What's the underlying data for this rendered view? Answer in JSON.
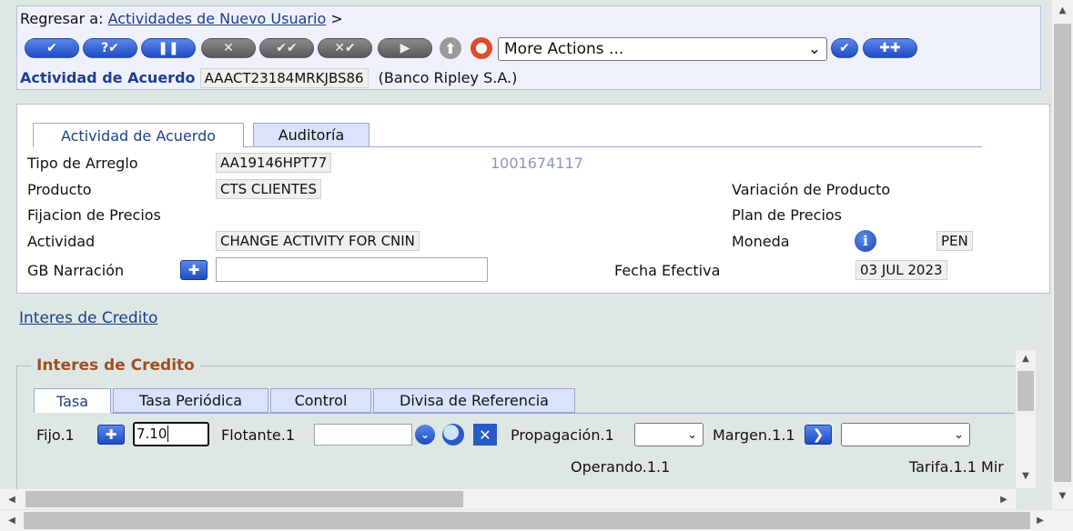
{
  "breadcrumb": {
    "prefix": "Regresar a:",
    "link": "Actividades de Nuevo Usuario",
    "suffix": ">"
  },
  "toolbar": {
    "buttons": [
      {
        "name": "commit-button",
        "glyph": "✔",
        "style": "blue"
      },
      {
        "name": "validate-button",
        "glyph": "?✔",
        "style": "blue"
      },
      {
        "name": "hold-button",
        "glyph": "❚❚",
        "style": "blue"
      },
      {
        "name": "delete-button",
        "glyph": "✕",
        "style": "gray"
      },
      {
        "name": "authorise-button",
        "glyph": "✔✔",
        "style": "gray"
      },
      {
        "name": "reverse-button",
        "glyph": "✕✔",
        "style": "gray"
      },
      {
        "name": "next-button",
        "glyph": "▶",
        "style": "gray"
      }
    ],
    "more_actions": "More Actions ..."
  },
  "record": {
    "label": "Actividad de Acuerdo",
    "id": "AAACT23184MRKJBS86",
    "bank": "(Banco Ripley S.A.)"
  },
  "main": {
    "tabs": [
      "Actividad de Acuerdo",
      "Auditoría"
    ],
    "fields": {
      "tipo_arreglo_label": "Tipo de Arreglo",
      "tipo_arreglo_value": "AA19146HPT77",
      "customer_number": "1001674117",
      "producto_label": "Producto",
      "producto_value": "CTS CLIENTES",
      "variacion_label": "Variación de Producto",
      "fijacion_label": "Fijacion de Precios",
      "plan_label": "Plan de Precios",
      "actividad_label": "Actividad",
      "actividad_value": "CHANGE ACTIVITY FOR CNIN",
      "moneda_label": "Moneda",
      "moneda_value": "PEN",
      "narracion_label": "GB Narración",
      "narracion_value": "",
      "fecha_label": "Fecha Efectiva",
      "fecha_value": "03 JUL 2023"
    }
  },
  "interes_link": "Interes de Credito",
  "interes": {
    "legend": "Interes de Credito",
    "tabs": [
      "Tasa",
      "Tasa Periódica",
      "Control",
      "Divisa de Referencia"
    ],
    "fijo_label": "Fijo.1",
    "fijo_value": "7.10",
    "flotante_label": "Flotante.1",
    "flotante_value": "",
    "propagacion_label": "Propagación.1",
    "margen_label": "Margen.1.1",
    "operando_label": "Operando.1.1",
    "tarifa_label": "Tarifa.1.1 Mir"
  }
}
